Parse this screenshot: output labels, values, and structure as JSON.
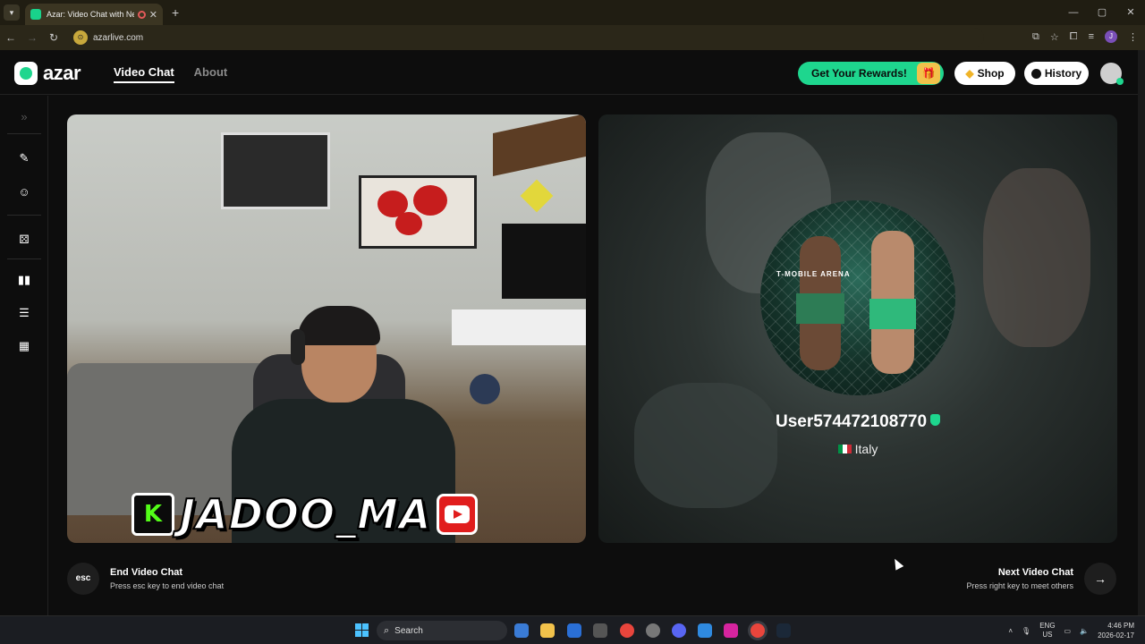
{
  "browser": {
    "tab_title": "Azar: Video Chat with New",
    "tab_close": "✕",
    "new_tab": "+",
    "url": "azarlive.com",
    "window_controls": [
      "—",
      "▢",
      "✕"
    ]
  },
  "header": {
    "logo_text": "azar",
    "nav": {
      "video_chat": "Video Chat",
      "about": "About"
    },
    "rewards_label": "Get Your Rewards!",
    "shop_label": "Shop",
    "history_label": "History"
  },
  "sidebar": {
    "items": [
      "expand-icon",
      "magic-wand-icon",
      "smiley-icon",
      "dice-icon",
      "layout-side-by-side-icon",
      "layout-stacked-icon",
      "layout-grid-icon"
    ]
  },
  "left_video": {
    "kick_letter": "K",
    "watermark_name": "JADOO_MA"
  },
  "right_video": {
    "banner_text": "T-MOBILE ARENA",
    "username": "User574472108770",
    "country": "Italy"
  },
  "controls": {
    "esc_label": "esc",
    "end_title": "End Video Chat",
    "end_subtitle": "Press esc key to end video chat",
    "next_title": "Next Video Chat",
    "next_subtitle": "Press right key to meet others",
    "next_arrow": "→"
  },
  "taskbar": {
    "search_placeholder": "Search",
    "lang_top": "ENG",
    "lang_bottom": "US",
    "time": "4:46 PM",
    "date": "2026-02-17"
  },
  "colors": {
    "accent": "#1ed68e",
    "background": "#0d0d0d"
  }
}
